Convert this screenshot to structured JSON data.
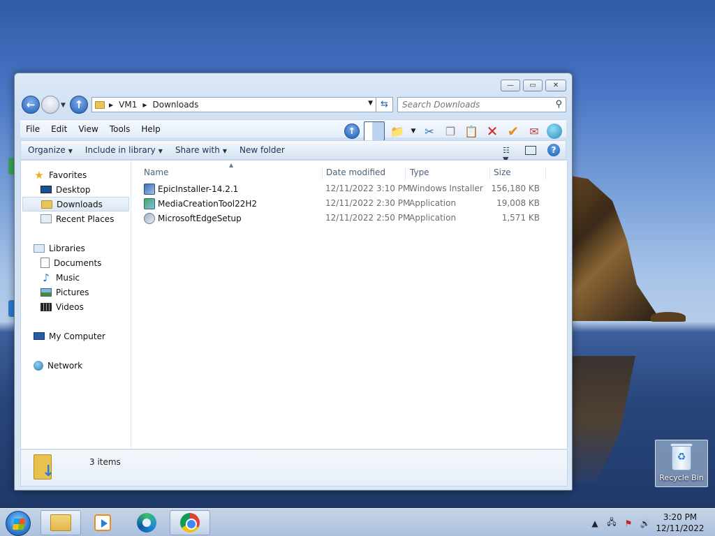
{
  "window": {
    "controls": {
      "minimize": "—",
      "maximize": "▭",
      "close": "✕"
    },
    "address": {
      "crumbs": [
        "VM1",
        "Downloads"
      ]
    },
    "search": {
      "placeholder": "Search Downloads"
    },
    "menu": [
      "File",
      "Edit",
      "View",
      "Tools",
      "Help"
    ],
    "commands": {
      "organize": "Organize",
      "include": "Include in library",
      "share": "Share with",
      "new_folder": "New folder"
    },
    "nav": {
      "favorites": "Favorites",
      "desktop": "Desktop",
      "downloads": "Downloads",
      "recent": "Recent Places",
      "libraries": "Libraries",
      "documents": "Documents",
      "music": "Music",
      "pictures": "Pictures",
      "videos": "Videos",
      "computer": "My Computer",
      "network": "Network"
    },
    "columns": {
      "name": "Name",
      "date": "Date modified",
      "type": "Type",
      "size": "Size"
    },
    "files": [
      {
        "name": "EpicInstaller-14.2.1",
        "date": "12/11/2022 3:10 PM",
        "type": "Windows Installer ...",
        "size": "156,180 KB",
        "icon": "msi-icon"
      },
      {
        "name": "MediaCreationTool22H2",
        "date": "12/11/2022 2:30 PM",
        "type": "Application",
        "size": "19,008 KB",
        "icon": "app-icon"
      },
      {
        "name": "MicrosoftEdgeSetup",
        "date": "12/11/2022 2:50 PM",
        "type": "Application",
        "size": "1,571 KB",
        "icon": "edge-setup-icon"
      }
    ],
    "status": {
      "count": "3 items"
    }
  },
  "desktop": {
    "recycle_bin": "Recycle Bin"
  },
  "taskbar": {
    "time": "3:20 PM",
    "date": "12/11/2022"
  },
  "colors": {
    "accent": "#1e5cb4",
    "selection": "#dde8f5"
  }
}
